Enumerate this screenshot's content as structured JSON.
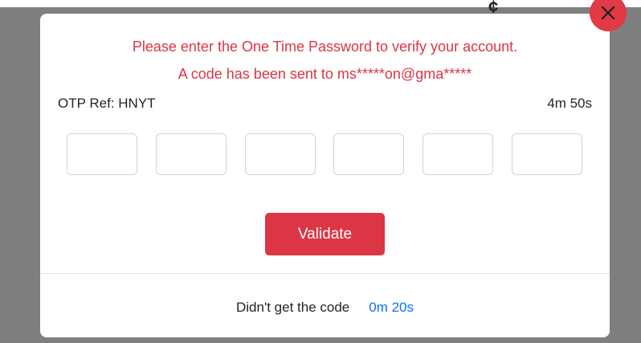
{
  "modal": {
    "message_line1": "Please enter the One Time Password to verify your account.",
    "message_line2": "A code has been sent to ms*****on@gma*****",
    "otp_ref": "OTP Ref: HNYT",
    "countdown": "4m 50s",
    "otp_digits": [
      "",
      "",
      "",
      "",
      "",
      ""
    ],
    "validate_label": "Validate",
    "resend_prompt": "Didn't get the code",
    "resend_countdown": "0m 20s",
    "close_icon": "close-x-icon"
  },
  "colors": {
    "accent": "#dc3545",
    "link": "#0d6efd",
    "backdrop": "#7f7f7f"
  }
}
